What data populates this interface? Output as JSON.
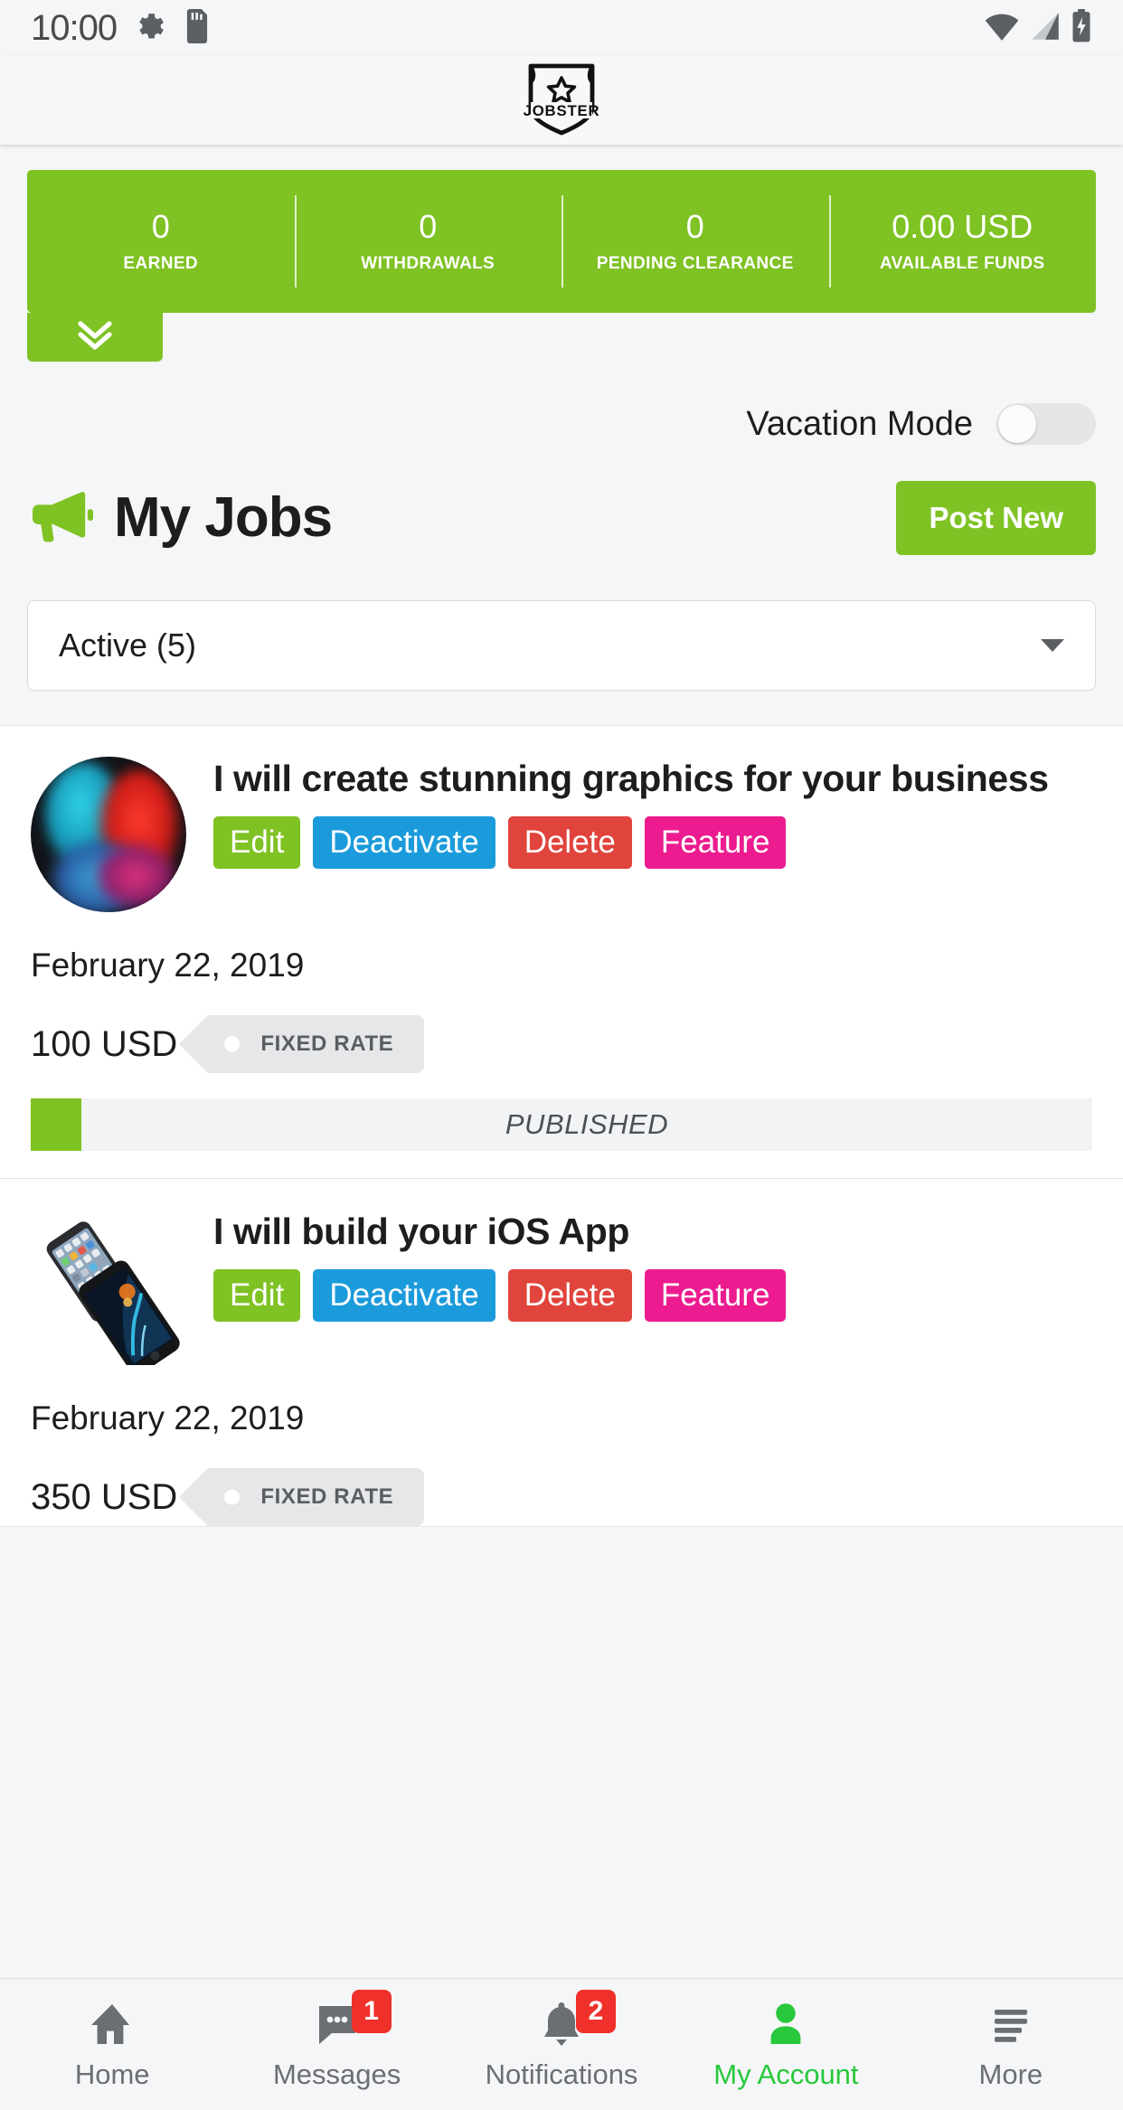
{
  "status_bar": {
    "time": "10:00",
    "icons": [
      "settings-gear-icon",
      "sd-card-icon",
      "wifi-icon",
      "cellular-signal-icon",
      "battery-charging-icon"
    ]
  },
  "app_bar": {
    "logo_text": "JOBSTER",
    "logo_icon": "shield-star-logo"
  },
  "stats": {
    "items": [
      {
        "value": "0",
        "label": "EARNED"
      },
      {
        "value": "0",
        "label": "WITHDRAWALS"
      },
      {
        "value": "0",
        "label": "PENDING CLEARANCE"
      },
      {
        "value": "0.00 USD",
        "label": "AVAILABLE FUNDS"
      }
    ],
    "expand_icon": "double-chevron-down-icon",
    "background_color": "#7fc224"
  },
  "vacation": {
    "label": "Vacation Mode",
    "enabled": false
  },
  "page_header": {
    "title": "My Jobs",
    "icon": "megaphone-icon",
    "post_new_label": "Post New"
  },
  "filter": {
    "selected": "Active (5)",
    "caret_icon": "chevron-down-icon"
  },
  "jobs": [
    {
      "thumb": "graphics-ink-avatar",
      "title": "I will create stunning graphics for your business",
      "actions": [
        {
          "label": "Edit",
          "color": "#7fc224",
          "name": "edit-button"
        },
        {
          "label": "Deactivate",
          "color": "#1b9bdb",
          "name": "deactivate-button"
        },
        {
          "label": "Delete",
          "color": "#e0443c",
          "name": "delete-button"
        },
        {
          "label": "Feature",
          "color": "#ec1b8f",
          "name": "feature-button"
        }
      ],
      "date": "February 22, 2019",
      "price": "100 USD",
      "rate_type": "FIXED RATE",
      "status": "PUBLISHED",
      "status_color": "#7fc224"
    },
    {
      "thumb": "ios-phones-image",
      "title": "I will build your iOS App",
      "actions": [
        {
          "label": "Edit",
          "color": "#7fc224",
          "name": "edit-button"
        },
        {
          "label": "Deactivate",
          "color": "#1b9bdb",
          "name": "deactivate-button"
        },
        {
          "label": "Delete",
          "color": "#e0443c",
          "name": "delete-button"
        },
        {
          "label": "Feature",
          "color": "#ec1b8f",
          "name": "feature-button"
        }
      ],
      "date": "February 22, 2019",
      "price": "350 USD",
      "rate_type": "FIXED RATE",
      "status": "",
      "status_color": "#7fc224"
    }
  ],
  "bottom_nav": {
    "items": [
      {
        "label": "Home",
        "icon": "home-icon",
        "badge": "",
        "active": false
      },
      {
        "label": "Messages",
        "icon": "chat-bubble-icon",
        "badge": "1",
        "active": false
      },
      {
        "label": "Notifications",
        "icon": "bell-icon",
        "badge": "2",
        "active": false
      },
      {
        "label": "My Account",
        "icon": "person-icon",
        "badge": "",
        "active": true
      },
      {
        "label": "More",
        "icon": "hamburger-menu-icon",
        "badge": "",
        "active": false
      }
    ],
    "active_color": "#28c83c",
    "badge_color": "#f0302a"
  }
}
